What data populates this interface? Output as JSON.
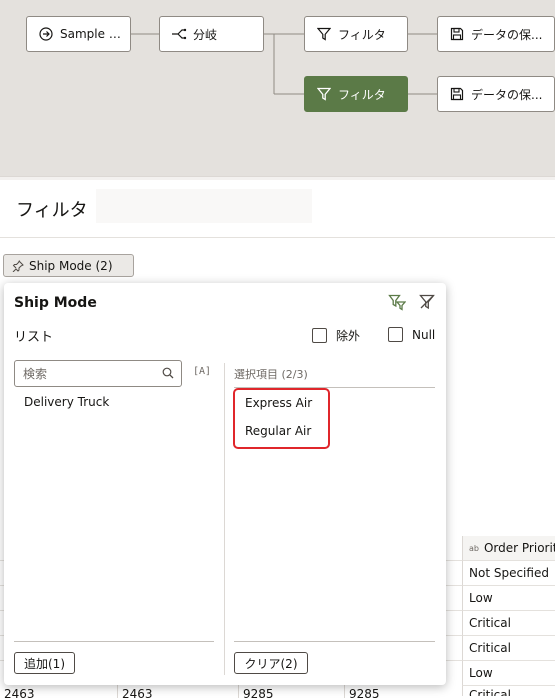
{
  "flow": {
    "nodes": [
      {
        "id": "source",
        "label": "Sample Or...",
        "icon": "arrow-circle-icon"
      },
      {
        "id": "branch",
        "label": "分岐",
        "icon": "branch-icon"
      },
      {
        "id": "filter1",
        "label": "フィルタ",
        "icon": "filter-icon"
      },
      {
        "id": "save1",
        "label": "データの保...",
        "icon": "save-icon"
      },
      {
        "id": "filter2",
        "label": "フィルタ",
        "icon": "filter-icon"
      },
      {
        "id": "save2",
        "label": "データの保...",
        "icon": "save-icon"
      }
    ]
  },
  "step": {
    "title": "フィルタ",
    "description_placeholder": ""
  },
  "chip": {
    "label": "Ship Mode (2)"
  },
  "popup": {
    "title": "Ship Mode",
    "list_label": "リスト",
    "exclude_label": "除外",
    "null_label": "Null",
    "search_placeholder": "検索",
    "case_toggle": "[A]",
    "available_items": [
      "Delivery Truck"
    ],
    "selected_header": "選択項目 (2/3)",
    "selected_items": [
      "Express Air",
      "Regular Air"
    ],
    "add_button": "追加(1)",
    "clear_button": "クリア(2)"
  },
  "table": {
    "column_header": "Order Priorit",
    "column_type": "ab",
    "rows": [
      "Not Specified",
      "Low",
      "Critical",
      "Critical",
      "Low",
      "Critical"
    ],
    "bottom_row": [
      "2463",
      "2463",
      "9285",
      "9285"
    ]
  },
  "colors": {
    "canvas_bg": "#e4e1dd",
    "active_node": "#5b7a47",
    "highlight_border": "#e0262b"
  }
}
